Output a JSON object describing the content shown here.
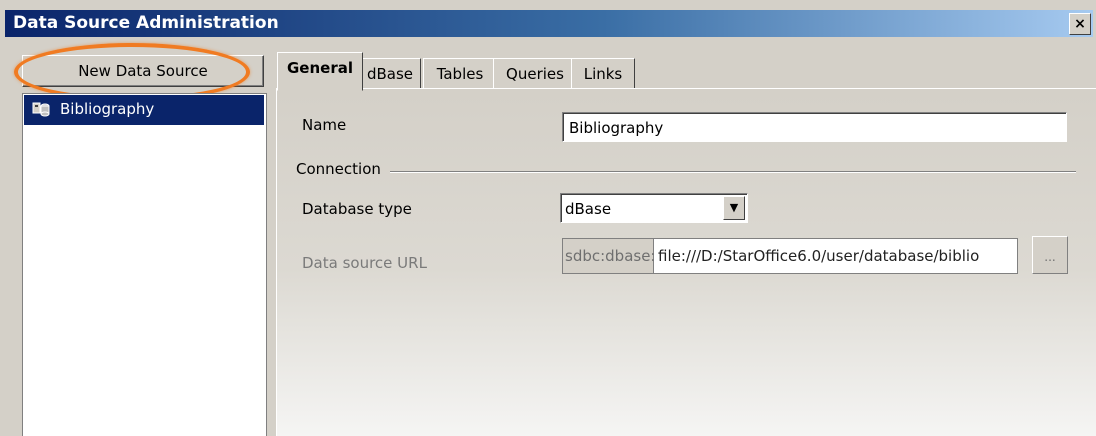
{
  "window": {
    "title": "Data Source Administration",
    "close_glyph": "×"
  },
  "left_panel": {
    "new_button_label": "New Data Source",
    "items": [
      {
        "label": "Bibliography",
        "icon": "database-icon",
        "selected": true
      }
    ]
  },
  "tabs": [
    {
      "label": "General",
      "active": true
    },
    {
      "label": "dBase",
      "active": false
    },
    {
      "label": "Tables",
      "active": false
    },
    {
      "label": "Queries",
      "active": false
    },
    {
      "label": "Links",
      "active": false
    }
  ],
  "general": {
    "name_label": "Name",
    "name_value": "Bibliography",
    "connection_heading": "Connection",
    "db_type_label": "Database type",
    "db_type_value": "dBase",
    "url_label": "Data source URL",
    "url_prefix": "sdbc:dbase:",
    "url_value": "file:///D:/StarOffice6.0/user/database/biblio",
    "browse_label": "..."
  },
  "colors": {
    "highlight_ring": "#f07b22",
    "selection": "#0a246a",
    "titlebar": "#0a246a"
  }
}
